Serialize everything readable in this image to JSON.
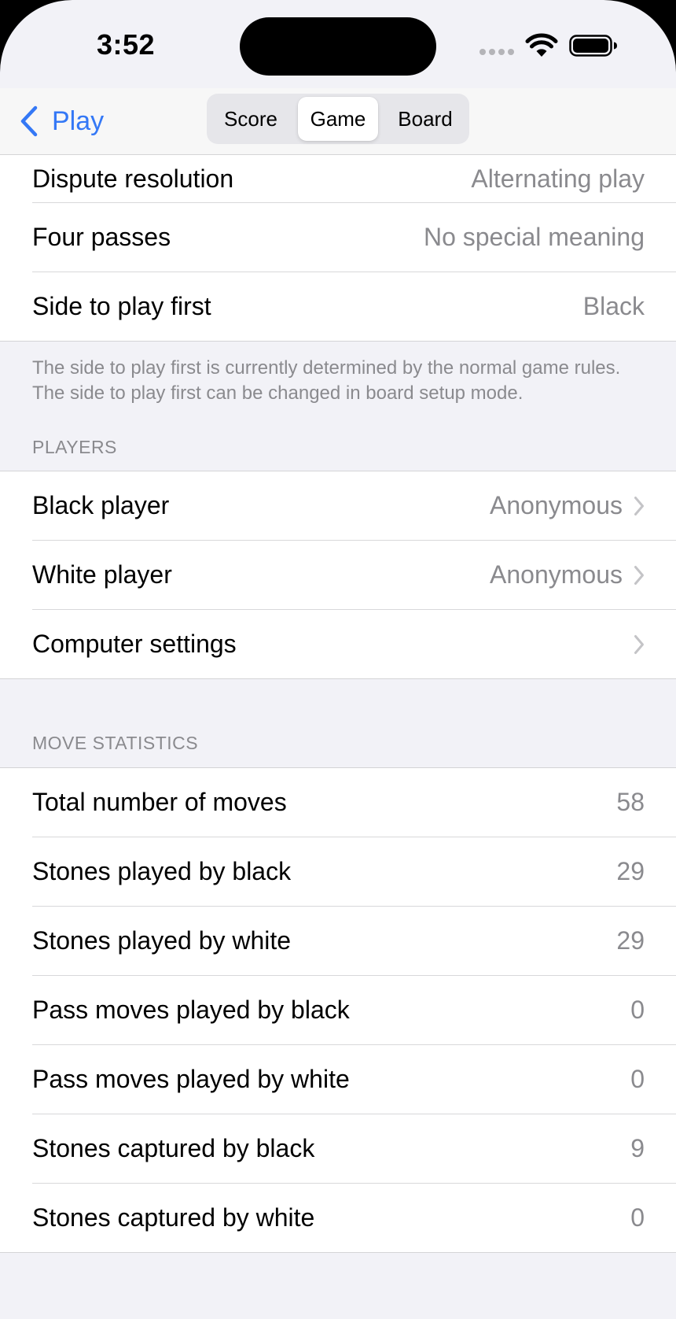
{
  "status_bar": {
    "time": "3:52",
    "icons": [
      "cellular-dots-icon",
      "wifi-icon",
      "battery-icon"
    ]
  },
  "nav": {
    "back_label": "Play",
    "segments": [
      "Score",
      "Game",
      "Board"
    ],
    "selected_segment": "Game"
  },
  "rules_group": {
    "rows": [
      {
        "label": "Dispute resolution",
        "value": "Alternating play"
      },
      {
        "label": "Four passes",
        "value": "No special meaning"
      },
      {
        "label": "Side to play first",
        "value": "Black"
      }
    ],
    "footer": "The side to play first is currently determined by the normal game rules. The side to play first can be changed in board setup mode."
  },
  "players": {
    "header": "PLAYERS",
    "rows": [
      {
        "label": "Black player",
        "value": "Anonymous"
      },
      {
        "label": "White player",
        "value": "Anonymous"
      },
      {
        "label": "Computer settings",
        "value": ""
      }
    ]
  },
  "move_statistics": {
    "header": "MOVE STATISTICS",
    "rows": [
      {
        "label": "Total number of moves",
        "value": "58"
      },
      {
        "label": "Stones played by black",
        "value": "29"
      },
      {
        "label": "Stones played by white",
        "value": "29"
      },
      {
        "label": "Pass moves played by black",
        "value": "0"
      },
      {
        "label": "Pass moves played by white",
        "value": "0"
      },
      {
        "label": "Stones captured by black",
        "value": "9"
      },
      {
        "label": "Stones captured by white",
        "value": "0"
      }
    ]
  },
  "colors": {
    "accent": "#3478f6",
    "background": "#f2f2f7",
    "secondary_text": "#8a8a8e"
  }
}
